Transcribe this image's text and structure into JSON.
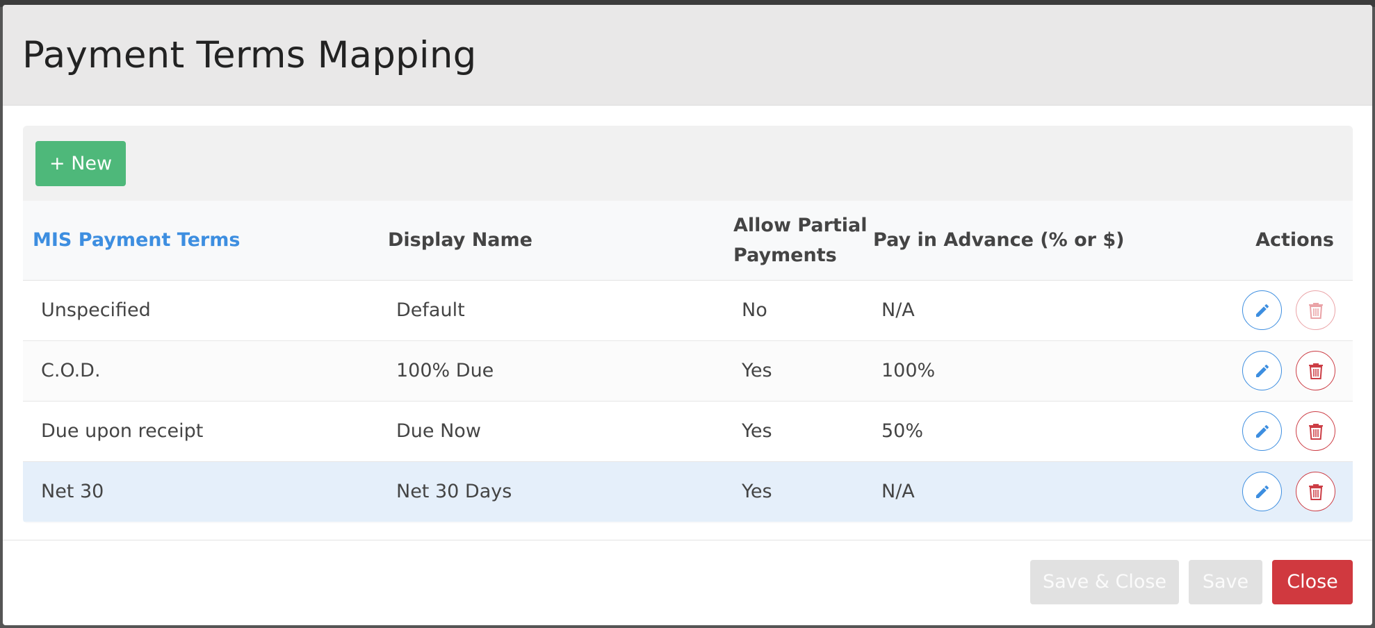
{
  "modal": {
    "title": "Payment Terms Mapping"
  },
  "toolbar": {
    "new_label": "+ New"
  },
  "table": {
    "headers": {
      "mis_terms": "MIS Payment Terms",
      "display_name": "Display Name",
      "allow_partial": "Allow Partial Payments",
      "pay_in_advance": "Pay in Advance (% or $)",
      "actions": "Actions"
    },
    "sorted_column": "MIS Payment Terms",
    "rows": [
      {
        "mis": "Unspecified",
        "display": "Default",
        "partial": "No",
        "advance": "N/A",
        "delete_enabled": false,
        "selected": false
      },
      {
        "mis": "C.O.D.",
        "display": "100% Due",
        "partial": "Yes",
        "advance": "100%",
        "delete_enabled": true,
        "selected": false
      },
      {
        "mis": "Due upon receipt",
        "display": "Due Now",
        "partial": "Yes",
        "advance": "50%",
        "delete_enabled": true,
        "selected": false
      },
      {
        "mis": "Net 30",
        "display": "Net 30 Days",
        "partial": "Yes",
        "advance": "N/A",
        "delete_enabled": true,
        "selected": true
      }
    ],
    "icons": {
      "edit": "pencil-icon",
      "delete": "trash-icon"
    }
  },
  "footer": {
    "save_close_label": "Save & Close",
    "save_label": "Save",
    "close_label": "Close"
  },
  "colors": {
    "accent": "#3d8ee0",
    "new_button": "#4eb87a",
    "danger": "#d0393f",
    "selected_row": "#e5effa"
  }
}
